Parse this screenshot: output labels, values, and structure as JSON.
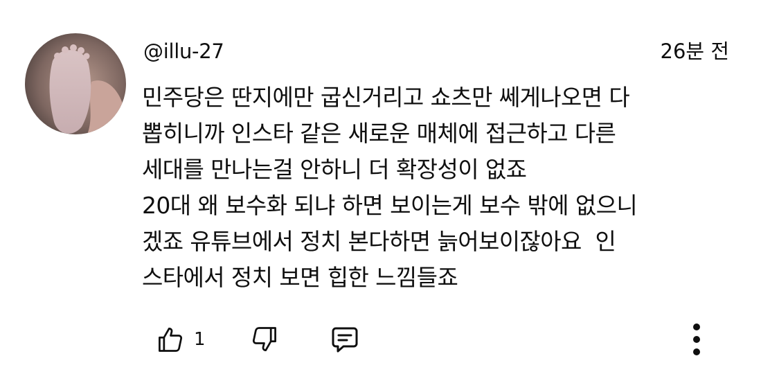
{
  "comment": {
    "author_handle": "@illu-27",
    "time_ago": "26분 전",
    "text_lines": [
      "민주당은 딴지에만 굽신거리고 쇼츠만 쎄게나오면 다",
      "뽑히니까 인스타 같은 새로운 매체에 접근하고 다른",
      "세대를 만나는걸 안하니 더 확장성이 없죠",
      "20대 왜 보수화 되냐 하면 보이는게 보수 밖에 없으니",
      "겠죠 유튜브에서 정치 본다하면 늙어보이잖아요  인",
      "스타에서 정치 보면 힙한 느낌들죠"
    ],
    "like_count": "1"
  },
  "icons": {
    "like": "thumbs-up-icon",
    "dislike": "thumbs-down-icon",
    "reply": "comment-reply-icon",
    "more": "vertical-ellipsis-icon"
  }
}
